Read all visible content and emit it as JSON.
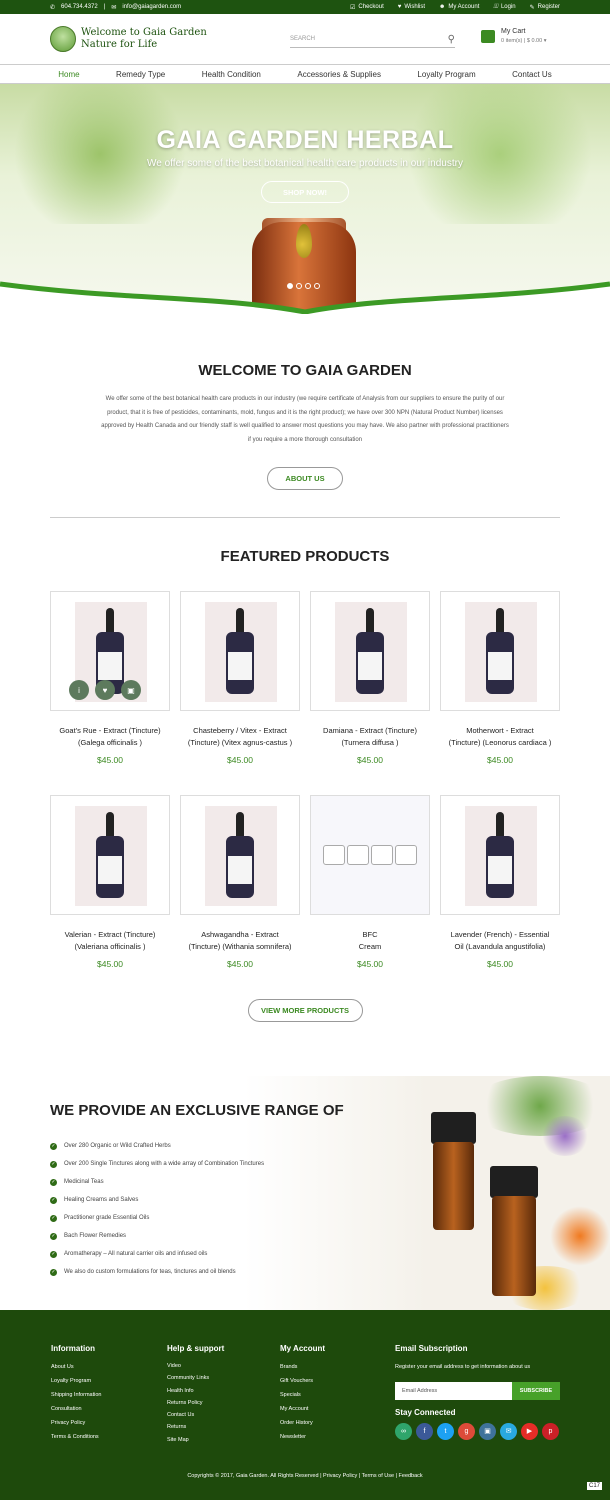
{
  "topbar": {
    "phone": "604.734.4372",
    "email": "info@gaiagarden.com",
    "checkout": "Checkout",
    "wishlist": "Wishlist",
    "my_account": "My Account",
    "login": "Login",
    "register": "Register"
  },
  "header": {
    "logo_line1": "Welcome to Gaia Garden",
    "logo_line2": "Nature for Life",
    "search_placeholder": "SEARCH",
    "cart_title": "My Cart",
    "cart_summary": "0 item(s) | $ 0.00"
  },
  "nav": {
    "items": [
      "Home",
      "Remedy Type",
      "Health Condition",
      "Accessories & Supplies",
      "Loyalty Program",
      "Contact Us"
    ]
  },
  "hero": {
    "title": "GAIA GARDEN HERBAL",
    "tagline": "We offer some of the best botanical health care products in our industry",
    "cta": "SHOP NOW!"
  },
  "welcome": {
    "title": "WELCOME TO GAIA GARDEN",
    "body": "We offer some of the best botanical health care products in our industry (we require certificate of Analysis from our suppliers to ensure the purity of our product, that it is free of pesticides, contaminants, mold, fungus and it is the right product); we have over 300 NPN (Natural Product Number) licenses approved by Health Canada and our friendly staff is well qualified to answer most questions you may have.  We also partner with professional practitioners if you require a more thorough consultation",
    "cta": "ABOUT US"
  },
  "featured": {
    "title": "FEATURED PRODUCTS",
    "products": [
      {
        "line1": "Goat's Rue - Extract (Tincture)",
        "line2": "(Galega officinalis )",
        "price": "$45.00"
      },
      {
        "line1": "Chasteberry / Vitex - Extract",
        "line2": "(Tincture) (Vitex agnus-castus )",
        "price": "$45.00"
      },
      {
        "line1": "Damiana - Extract (Tincture)",
        "line2": "(Turnera diffusa )",
        "price": "$45.00"
      },
      {
        "line1": "Motherwort - Extract",
        "line2": "(Tincture) (Leonorus cardiaca )",
        "price": "$45.00"
      },
      {
        "line1": "Valerian - Extract (Tincture)",
        "line2": "(Valeriana officinalis )",
        "price": "$45.00"
      },
      {
        "line1": "Ashwagandha - Extract",
        "line2": "(Tincture) (Withania somnifera)",
        "price": "$45.00"
      },
      {
        "line1": "BFC",
        "line2": "Cream",
        "price": "$45.00"
      },
      {
        "line1": "Lavender (French) - Essential",
        "line2": "Oil (Lavandula angustifolia)",
        "price": "$45.00"
      }
    ],
    "view_more": "VIEW MORE PRODUCTS"
  },
  "range": {
    "title": "WE PROVIDE AN EXCLUSIVE RANGE OF",
    "items": [
      "Over 280 Organic or Wild Crafted Herbs",
      "Over 200 Single Tinctures along with a wide array of Combination Tinctures",
      "Medicinal Teas",
      "Healing Creams and Salves",
      "Practitioner grade Essential Oils",
      "Bach Flower Remedies",
      "Aromatherapy – All natural carrier oils and infused oils",
      "We also do custom formulations for teas, tinctures and oil blends"
    ]
  },
  "footer": {
    "information": {
      "title": "Information",
      "links": [
        "About Us",
        "Loyalty Program",
        "Shipping Information",
        "Consultation",
        "Privacy Policy",
        "Terms & Conditions"
      ]
    },
    "help": {
      "title": "Help & support",
      "links": [
        "Video",
        "Community Links",
        "Health Info",
        "Returns Policy",
        "Contact Us",
        "Returns",
        "Site Map"
      ]
    },
    "account": {
      "title": "My Account",
      "links": [
        "Brands",
        "Gift Vouchers",
        "Specials",
        "My Account",
        "Order History",
        "Newsletter"
      ]
    },
    "subscription": {
      "title": "Email Subscription",
      "text": "Register your email address to get information about us",
      "placeholder": "Email Address",
      "button": "SUBSCRIBE",
      "stay": "Stay Connected"
    },
    "copyright": "Copyrights © 2017, Gaia Garden. All Rights Reserved   |   Privacy Policy  |  Terms of Use  |  Feedback",
    "badge": "C17"
  },
  "colors": {
    "brand_green": "#1e5310",
    "accent_green": "#3c8a22",
    "footer_bg": "#1e4a0c"
  }
}
